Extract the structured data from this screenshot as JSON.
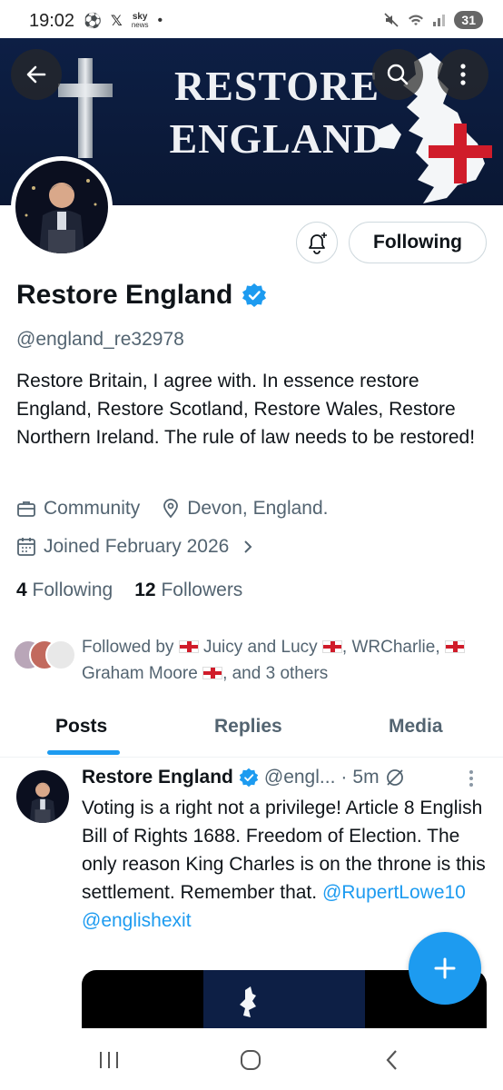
{
  "status_bar": {
    "time": "19:02",
    "left_icons": [
      "football-icon",
      "x-icon",
      "sky-news-icon",
      "dot-icon"
    ],
    "sky_line1": "sky",
    "sky_line2": "news",
    "battery": "31"
  },
  "banner": {
    "title_line1": "RESTORE",
    "title_line2": "ENGLAND"
  },
  "profile": {
    "name": "Restore England",
    "handle": "@england_re32978",
    "bio": "Restore Britain, I agree with.  In essence restore England, Restore Scotland, Restore Wales, Restore Northern Ireland.  The rule of law needs to be restored!",
    "category": "Community",
    "location": "Devon, England.",
    "joined": "Joined February 2026",
    "following_count": "4",
    "following_label": "Following",
    "followers_count": "12",
    "followers_label": "Followers",
    "follow_button": "Following"
  },
  "followed_by": {
    "prefix": "Followed by",
    "name1": "Juicy and Lucy",
    "name2": "WRCharlie,",
    "name3": "Graham Moore",
    "suffix": ", and 3 others"
  },
  "tabs": [
    {
      "label": "Posts",
      "active": true
    },
    {
      "label": "Replies",
      "active": false
    },
    {
      "label": "Media",
      "active": false
    }
  ],
  "post": {
    "author": "Restore England",
    "handle": "@engl...",
    "separator": "·",
    "time": "5m",
    "text": "Voting is a right not a privilege!  Article 8 English Bill of Rights 1688.  Freedom of Election.  The only reason King Charles is on the throne is this settlement. Remember that.",
    "mention1": "@RupertLowe10",
    "mention2": "@englishexit"
  },
  "colors": {
    "accent": "#1d9bf0",
    "banner_bg": "#0d1f45",
    "secondary_text": "#536471",
    "flag_red": "#d01c2a"
  }
}
